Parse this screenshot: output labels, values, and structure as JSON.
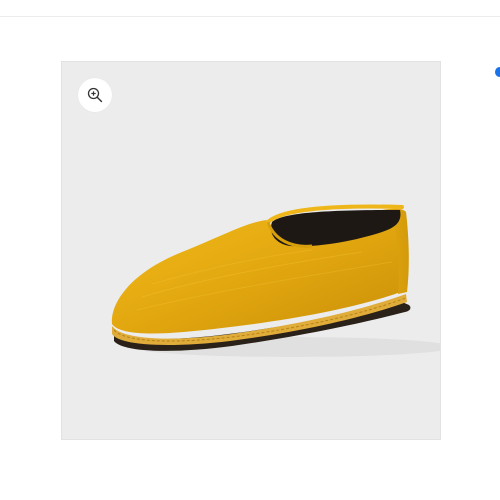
{
  "gallery": {
    "background_color": "#ececec",
    "zoom_icon": "zoom-in-icon",
    "product_color": "#e5aa12",
    "sole_color": "#2a2118",
    "insole_color": "#1e1814",
    "accent_color": "#1a73e8"
  }
}
